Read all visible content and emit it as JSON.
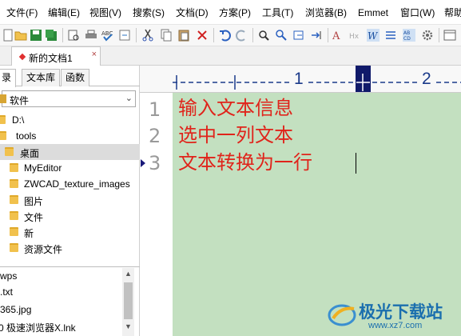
{
  "menu": [
    "文件(F)",
    "编辑(E)",
    "视图(V)",
    "搜索(S)",
    "文档(D)",
    "方案(P)",
    "工具(T)",
    "浏览器(B)",
    "Emmet",
    "窗口(W)",
    "帮助"
  ],
  "toolbar": {
    "icons": [
      "new-file-icon",
      "open-folder-icon",
      "save-icon",
      "save-all-icon",
      "print-preview-icon",
      "print-icon",
      "spell-check-icon",
      "word-wrap-icon",
      "cut-icon",
      "copy-icon",
      "paste-icon",
      "delete-icon",
      "undo-icon",
      "redo-icon",
      "find-icon",
      "find-next-icon",
      "replace-icon",
      "goto-icon",
      "font-icon",
      "hex-icon",
      "wrap-toggle-icon",
      "column-mode-icon",
      "sort-icon",
      "settings-icon",
      "panel-icon"
    ]
  },
  "tab": {
    "label": "新的文档1",
    "close": "×"
  },
  "panel": {
    "tabs": [
      "录",
      "文本库",
      "函数"
    ],
    "drive": "软件",
    "tree": [
      {
        "label": "D:\\",
        "indent": 0
      },
      {
        "label": "tools",
        "indent": 1
      },
      {
        "label": "桌面",
        "indent": 1,
        "selected": true
      },
      {
        "label": "MyEditor",
        "indent": 2
      },
      {
        "label": "ZWCAD_texture_images",
        "indent": 2
      },
      {
        "label": "图片",
        "indent": 2
      },
      {
        "label": "文件",
        "indent": 2
      },
      {
        "label": "新",
        "indent": 2
      },
      {
        "label": "资源文件",
        "indent": 2
      }
    ],
    "files": [
      "wps",
      ".txt",
      "365.jpg",
      "0 极速浏览器X.lnk"
    ]
  },
  "ruler": {
    "marks": [
      "1",
      "2"
    ]
  },
  "editor": {
    "line_numbers": [
      "1",
      "2",
      "3"
    ],
    "lines": [
      "输入文本信息",
      "选中一列文本",
      "文本转换为一行"
    ],
    "bg": "#c3e0c0",
    "text_color": "#e0241b"
  },
  "watermark": {
    "title": "极光下载站",
    "url": "www.xz7.com"
  }
}
